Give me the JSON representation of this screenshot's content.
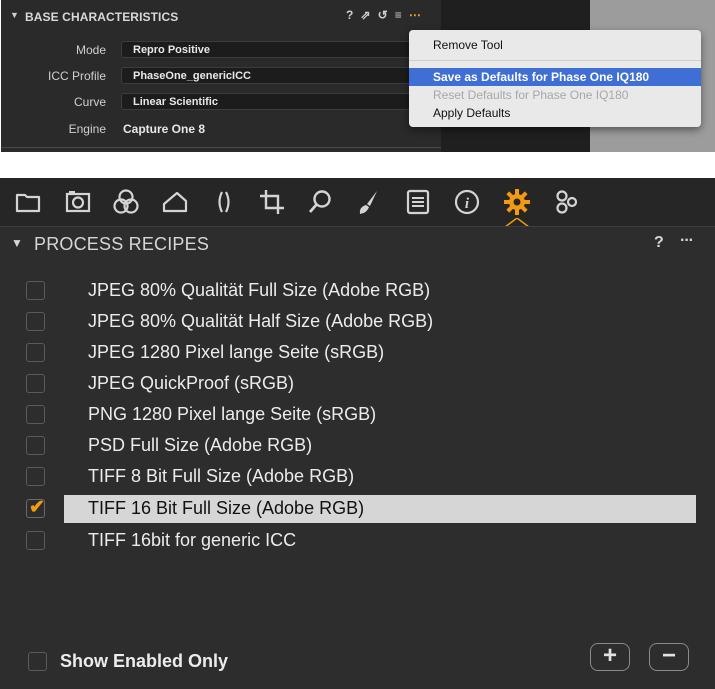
{
  "base_characteristics": {
    "title": "BASE CHARACTERISTICS",
    "header_icons": {
      "help": "?",
      "copy": "⇗",
      "reset": "↺",
      "list": "≡",
      "more": "⋯"
    },
    "rows": [
      {
        "label": "Mode",
        "value": "Repro Positive"
      },
      {
        "label": "ICC Profile",
        "value": "PhaseOne_genericICC"
      },
      {
        "label": "Curve",
        "value": "Linear Scientific"
      },
      {
        "label": "Engine",
        "value": "Capture One 8"
      }
    ],
    "context_menu": {
      "items": [
        {
          "label": "Remove Tool",
          "state": "normal"
        },
        {
          "label": "Save as Defaults for Phase One IQ180",
          "state": "highlighted"
        },
        {
          "label": "Reset Defaults for Phase One IQ180",
          "state": "disabled"
        },
        {
          "label": "Apply Defaults",
          "state": "normal"
        }
      ]
    }
  },
  "toolbar": {
    "tabs": [
      {
        "name": "library-tab",
        "icon": "folder-icon"
      },
      {
        "name": "capture-tab",
        "icon": "camera-icon"
      },
      {
        "name": "color-tab",
        "icon": "color-circles-icon"
      },
      {
        "name": "exposure-tab",
        "icon": "exposure-icon"
      },
      {
        "name": "lens-tab",
        "icon": "lens-icon"
      },
      {
        "name": "composition-tab",
        "icon": "crop-icon"
      },
      {
        "name": "details-tab",
        "icon": "loupe-icon"
      },
      {
        "name": "adjustments-tab",
        "icon": "brush-icon"
      },
      {
        "name": "metadata-tab",
        "icon": "metadata-icon"
      },
      {
        "name": "info-tab",
        "icon": "info-icon"
      },
      {
        "name": "output-tab",
        "icon": "gear-icon",
        "active": true
      },
      {
        "name": "batch-tab",
        "icon": "gears-icon"
      }
    ],
    "accent_color": "#f29a12"
  },
  "process_recipes": {
    "title": "PROCESS RECIPES",
    "help": "?",
    "more": "···",
    "recipes": [
      {
        "name": "JPEG 80% Qualität Full Size (Adobe RGB)",
        "checked": false
      },
      {
        "name": "JPEG 80% Qualität Half Size (Adobe RGB)",
        "checked": false
      },
      {
        "name": "JPEG 1280 Pixel lange Seite (sRGB)",
        "checked": false
      },
      {
        "name": "JPEG QuickProof (sRGB)",
        "checked": false
      },
      {
        "name": "PNG 1280 Pixel lange Seite (sRGB)",
        "checked": false
      },
      {
        "name": "PSD Full Size (Adobe RGB)",
        "checked": false
      },
      {
        "name": "TIFF 8 Bit Full Size (Adobe RGB)",
        "checked": false
      },
      {
        "name": "TIFF 16 Bit Full Size (Adobe RGB)",
        "checked": true,
        "selected": true
      },
      {
        "name": "TIFF 16bit for generic ICC",
        "checked": false
      }
    ],
    "footer": {
      "show_enabled_label": "Show Enabled Only",
      "add_label": "+",
      "remove_label": "−"
    }
  }
}
